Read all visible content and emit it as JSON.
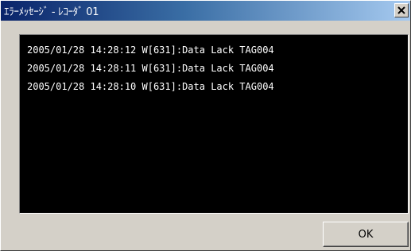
{
  "window": {
    "title": "ｴﾗｰﾒｯｾｰｼﾞ - ﾚｺｰﾀﾞ 01",
    "close_icon": "close-icon",
    "titlebar_color_start": "#0a246a",
    "titlebar_color_end": "#a6caf0"
  },
  "log": {
    "lines": [
      "2005/01/28 14:28:12 W[631]:Data Lack TAG004",
      "2005/01/28 14:28:11 W[631]:Data Lack TAG004",
      "2005/01/28 14:28:10 W[631]:Data Lack TAG004"
    ],
    "background": "#000000",
    "text_color": "#ffffff"
  },
  "buttons": {
    "ok_label": "OK"
  }
}
